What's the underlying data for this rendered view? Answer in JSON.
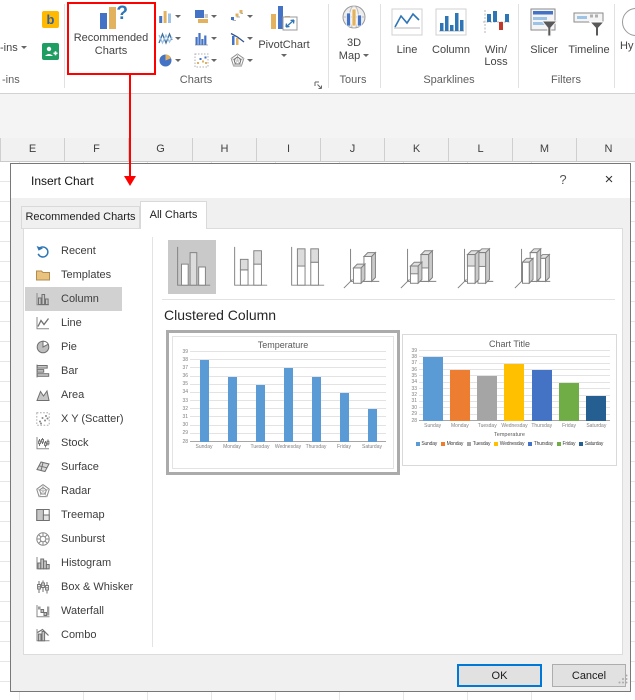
{
  "ribbon": {
    "addins_button_label": "-ins",
    "addins_group_label": "-ins",
    "bing_glyph": "b",
    "recommended_charts_label": "Recommended Charts",
    "recommended_question_glyph": "?",
    "charts_group_label": "Charts",
    "chart_type_buttons": [
      "column-chart",
      "stacked-bar-chart",
      "waterfall-chart",
      "line-chart",
      "clustered-column-chart",
      "combo-chart",
      "pie-chart",
      "scatter-chart",
      "radar-chart"
    ],
    "pivotchart_label": "PivotChart",
    "map_3d_label": "3D Map",
    "tours_group_label": "Tours",
    "sparkline_labels": [
      "Line",
      "Column",
      "Win/ Loss"
    ],
    "sparklines_group_label": "Sparklines",
    "slicer_label": "Slicer",
    "timeline_label": "Timeline",
    "filters_group_label": "Filters",
    "hyperlink_partial_label": "Hy",
    "annotation_color": "#FF0000"
  },
  "sheet": {
    "columns": [
      "E",
      "F",
      "G",
      "H",
      "I",
      "J",
      "K",
      "L",
      "M",
      "N"
    ]
  },
  "dialog": {
    "title": "Insert Chart",
    "help_glyph": "?",
    "close_glyph": "×",
    "tabs": [
      {
        "label": "Recommended Charts",
        "active": false
      },
      {
        "label": "All Charts",
        "active": true
      }
    ],
    "sidebar": [
      {
        "icon": "recent-icon",
        "label": "Recent"
      },
      {
        "icon": "templates-icon",
        "label": "Templates"
      },
      {
        "icon": "column-chart-icon",
        "label": "Column",
        "selected": true
      },
      {
        "icon": "line-chart-icon",
        "label": "Line"
      },
      {
        "icon": "pie-chart-icon",
        "label": "Pie"
      },
      {
        "icon": "bar-chart-icon",
        "label": "Bar"
      },
      {
        "icon": "area-chart-icon",
        "label": "Area"
      },
      {
        "icon": "scatter-chart-icon",
        "label": "X Y (Scatter)"
      },
      {
        "icon": "stock-chart-icon",
        "label": "Stock"
      },
      {
        "icon": "surface-chart-icon",
        "label": "Surface"
      },
      {
        "icon": "radar-chart-icon",
        "label": "Radar"
      },
      {
        "icon": "treemap-icon",
        "label": "Treemap"
      },
      {
        "icon": "sunburst-icon",
        "label": "Sunburst"
      },
      {
        "icon": "histogram-icon",
        "label": "Histogram"
      },
      {
        "icon": "box-whisker-icon",
        "label": "Box & Whisker"
      },
      {
        "icon": "waterfall-icon",
        "label": "Waterfall"
      },
      {
        "icon": "combo-icon",
        "label": "Combo"
      }
    ],
    "subtype_heading": "Clustered Column",
    "subtypes": [
      {
        "name": "clustered-column",
        "selected": true
      },
      {
        "name": "stacked-column",
        "selected": false
      },
      {
        "name": "100-stacked-column",
        "selected": false
      },
      {
        "name": "3d-clustered-column",
        "selected": false
      },
      {
        "name": "3d-stacked-column",
        "selected": false
      },
      {
        "name": "3d-100-stacked-column",
        "selected": false
      },
      {
        "name": "3d-column",
        "selected": false
      }
    ],
    "ok_label": "OK",
    "cancel_label": "Cancel"
  },
  "chart_data": [
    {
      "type": "bar",
      "title": "Temperature",
      "categories": [
        "Sunday",
        "Monday",
        "Tuesday",
        "Wednesday",
        "Thursday",
        "Friday",
        "Saturday"
      ],
      "values": [
        38,
        36,
        35,
        37,
        36,
        34,
        32
      ],
      "ylim": [
        28,
        39
      ],
      "ytick_step": 1,
      "bar_color": "#5B9BD5",
      "grid": true,
      "legend_position": "none",
      "selected_preview": true
    },
    {
      "type": "bar",
      "title": "Chart Title",
      "categories": [
        "Sunday",
        "Monday",
        "Tuesday",
        "Wednesday",
        "Thursday",
        "Friday",
        "Saturday"
      ],
      "values": [
        38,
        36,
        35,
        37,
        36,
        34,
        32
      ],
      "ylim": [
        28,
        39
      ],
      "ytick_step": 1,
      "series_colors": [
        "#5B9BD5",
        "#ED7D31",
        "#A5A5A5",
        "#FFC000",
        "#4472C4",
        "#70AD47",
        "#255E91"
      ],
      "xlabel": "Temperature",
      "grid": true,
      "legend_position": "bottom",
      "selected_preview": false
    }
  ]
}
